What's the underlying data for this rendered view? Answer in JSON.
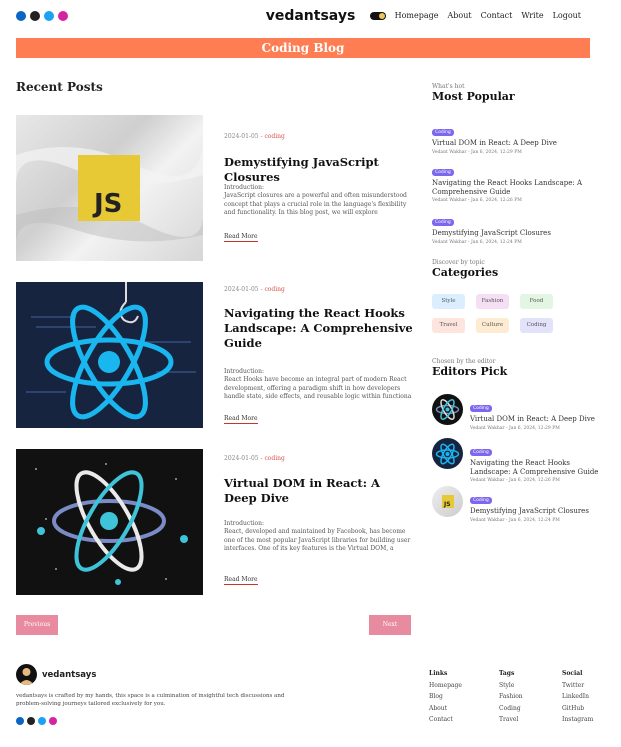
{
  "header": {
    "logo": "vedantsays",
    "nav": [
      "Homepage",
      "About",
      "Contact",
      "Write",
      "Logout"
    ],
    "social_icons": [
      "linkedin-icon",
      "github-icon",
      "twitter-icon",
      "instagram-icon"
    ]
  },
  "banner": {
    "title": "Coding Blog"
  },
  "recent": {
    "title": "Recent Posts",
    "posts": [
      {
        "date": "2024-01-05",
        "category": "coding",
        "title": "Demystifying JavaScript Closures",
        "intro": "Introduction:",
        "excerpt": "JavaScript closures are a powerful and often misunderstood concept that plays a crucial role in the language's flexibility and functionality. In this blog post, we will explore",
        "read_more": "Read More"
      },
      {
        "date": "2024-01-05",
        "category": "coding",
        "title": "Navigating the React Hooks Landscape: A Comprehensive Guide",
        "intro": "Introduction:",
        "excerpt": "React Hooks have become an integral part of modern React development, offering a paradigm shift in how developers handle state, side effects, and reusable logic within functiona",
        "read_more": "Read More"
      },
      {
        "date": "2024-01-05",
        "category": "coding",
        "title": "Virtual DOM in React: A Deep Dive",
        "intro": "Introduction:",
        "excerpt": "React, developed and maintained by Facebook, has become one of the most popular JavaScript libraries for building user interfaces. One of its key features is the Virtual DOM, a",
        "read_more": "Read More"
      }
    ],
    "pagination": {
      "prev": "Previous",
      "next": "Next"
    }
  },
  "sidebar": {
    "popular": {
      "kicker": "What's hot",
      "title": "Most Popular",
      "items": [
        {
          "badge": "Coding",
          "title": "Virtual DOM in React: A Deep Dive",
          "meta": "Vedant Wakhar - Jan 6, 2024, 12:29 PM"
        },
        {
          "badge": "Coding",
          "title": "Navigating the React Hooks Landscape: A Comprehensive Guide",
          "meta": "Vedant Wakhar - Jan 6, 2024, 12:26 PM"
        },
        {
          "badge": "Coding",
          "title": "Demystifying JavaScript Closures",
          "meta": "Vedant Wakhar - Jan 6, 2024, 12:24 PM"
        }
      ]
    },
    "categories": {
      "kicker": "Discover by topic",
      "title": "Categories",
      "items": [
        {
          "label": "Style",
          "color": "#dbeeff"
        },
        {
          "label": "Fashion",
          "color": "#f5dff5"
        },
        {
          "label": "Food",
          "color": "#e3f5e3"
        },
        {
          "label": "Travel",
          "color": "#fde4dc"
        },
        {
          "label": "Culture",
          "color": "#fdecd2"
        },
        {
          "label": "Coding",
          "color": "#e3e2fb"
        }
      ]
    },
    "editors": {
      "kicker": "Chosen by the editor",
      "title": "Editors Pick",
      "items": [
        {
          "badge": "Coding",
          "title": "Virtual DOM in React: A Deep Dive",
          "meta": "Vedant Wakhar - Jan 6, 2024, 12:29 PM"
        },
        {
          "badge": "Coding",
          "title": "Navigating the React Hooks Landscape: A Comprehensive Guide",
          "meta": "Vedant Wakhar - Jan 6, 2024, 12:26 PM"
        },
        {
          "badge": "Coding",
          "title": "Demystifying JavaScript Closures",
          "meta": "Vedant Wakhar - Jan 6, 2024, 12:24 PM"
        }
      ]
    }
  },
  "footer": {
    "name": "vedantsays",
    "description": "vedantsays is crafted by my hands, this space is a culmination of insightful tech discussions and problem-solving journeys tailored exclusively for you.",
    "columns": [
      {
        "title": "Links",
        "items": [
          "Homepage",
          "Blog",
          "About",
          "Contact"
        ]
      },
      {
        "title": "Tags",
        "items": [
          "Style",
          "Fashion",
          "Coding",
          "Travel"
        ]
      },
      {
        "title": "Social",
        "items": [
          "Twitter",
          "LinkedIn",
          "GitHub",
          "Instagram"
        ]
      }
    ]
  },
  "colors": {
    "accent": "#fe7d53",
    "pager": "#e88aa0",
    "badge": "#7b68ee",
    "category_text": "#d9534f"
  }
}
